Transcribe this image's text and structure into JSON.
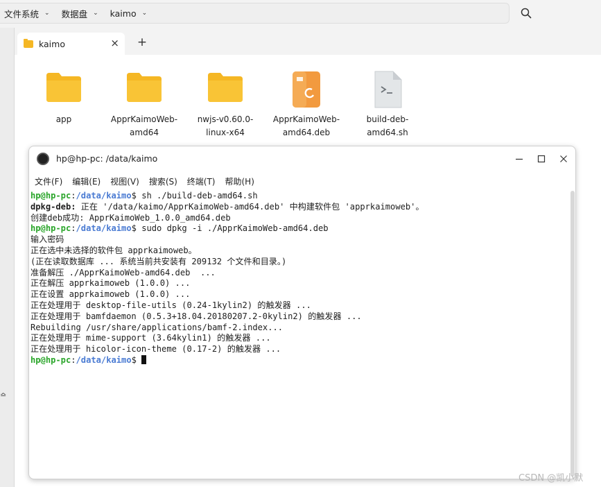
{
  "breadcrumb": [
    {
      "label": "文件系统"
    },
    {
      "label": "数据盘"
    },
    {
      "label": "kaimo"
    }
  ],
  "tab": {
    "label": "kaimo",
    "close": "×"
  },
  "add_tab": "+",
  "left_strip_glyph": "≏",
  "files": [
    {
      "name": "app",
      "icon": "folder-icon"
    },
    {
      "name": "ApprKaimoWeb-amd64",
      "icon": "folder-icon"
    },
    {
      "name": "nwjs-v0.60.0-linux-x64",
      "icon": "folder-icon"
    },
    {
      "name": "ApprKaimoWeb-amd64.deb",
      "icon": "deb-package-icon"
    },
    {
      "name": "build-deb-amd64.sh",
      "icon": "shell-script-icon"
    }
  ],
  "terminal": {
    "title": "hp@hp-pc: /data/kaimo",
    "menu": [
      "文件(F)",
      "编辑(E)",
      "视图(V)",
      "搜索(S)",
      "终端(T)",
      "帮助(H)"
    ],
    "prompt_user": "hp@hp-pc",
    "prompt_path": "/data/kaimo",
    "lines": [
      {
        "kind": "prompt",
        "sep": ":",
        "end": "$ ",
        "text": "sh ./build-deb-amd64.sh"
      },
      {
        "kind": "labeled",
        "label": "dpkg-deb:",
        "text": " 正在 '/data/kaimo/ApprKaimoWeb-amd64.deb' 中构建软件包 'apprkaimoweb'。"
      },
      {
        "kind": "text",
        "text": "创建deb成功: ApprKaimoWeb_1.0.0_amd64.deb"
      },
      {
        "kind": "prompt",
        "sep": ":",
        "end": "$ ",
        "text": "sudo dpkg -i ./ApprKaimoWeb-amd64.deb"
      },
      {
        "kind": "text",
        "text": "输入密码"
      },
      {
        "kind": "text",
        "text": "正在选中未选择的软件包 apprkaimoweb。"
      },
      {
        "kind": "text",
        "text": "(正在读取数据库 ... 系统当前共安装有 209132 个文件和目录。)"
      },
      {
        "kind": "text",
        "text": "准备解压 ./ApprKaimoWeb-amd64.deb  ..."
      },
      {
        "kind": "text",
        "text": "正在解压 apprkaimoweb (1.0.0) ..."
      },
      {
        "kind": "text",
        "text": "正在设置 apprkaimoweb (1.0.0) ..."
      },
      {
        "kind": "text",
        "text": "正在处理用于 desktop-file-utils (0.24-1kylin2) 的触发器 ..."
      },
      {
        "kind": "text",
        "text": "正在处理用于 bamfdaemon (0.5.3+18.04.20180207.2-0kylin2) 的触发器 ..."
      },
      {
        "kind": "text",
        "text": "Rebuilding /usr/share/applications/bamf-2.index..."
      },
      {
        "kind": "text",
        "text": "正在处理用于 mime-support (3.64kylin1) 的触发器 ..."
      },
      {
        "kind": "text",
        "text": "正在处理用于 hicolor-icon-theme (0.17-2) 的触发器 ..."
      },
      {
        "kind": "prompt",
        "sep": ":",
        "end": "$ ",
        "text": "",
        "cursor": true
      }
    ]
  },
  "watermark": "CSDN @凯小默",
  "colors": {
    "prompt_user": "#2aa52a",
    "prompt_path": "#4a7bd3",
    "folder": "#f5b724",
    "deb_orange": "#f29a3f"
  }
}
